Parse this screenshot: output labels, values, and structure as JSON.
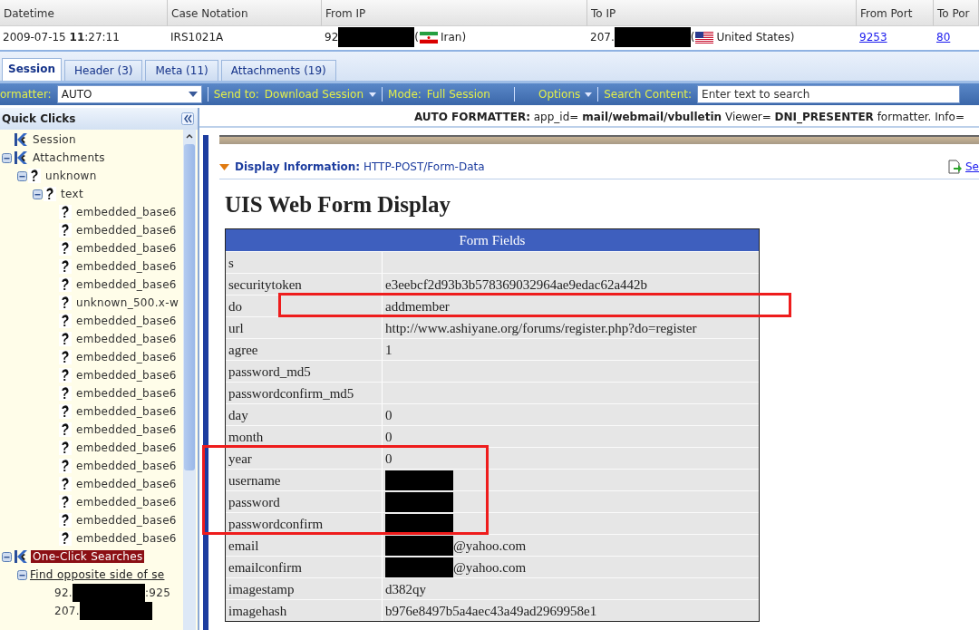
{
  "case_table": {
    "columns": [
      "Datetime",
      "Case Notation",
      "From IP",
      "To IP",
      "From Port",
      "To Por"
    ],
    "row": {
      "datetime": "2009-07-15 **11**:27:11",
      "case_notation": "IRS1021A",
      "from_ip": {
        "prefix": "92",
        "redacted": true,
        "lead": "(",
        "country": "Iran)"
      },
      "to_ip": {
        "prefix": "207.",
        "redacted": true,
        "lead": "(",
        "country": "United States)"
      },
      "from_port": "9253",
      "to_port": "80"
    }
  },
  "tabs": [
    {
      "label": "Session",
      "selected": true
    },
    {
      "label": "Header (3)",
      "selected": false
    },
    {
      "label": "Meta (11)",
      "selected": false
    },
    {
      "label": "Attachments (19)",
      "selected": false
    }
  ],
  "toolbar": {
    "formatter_label": "ormatter:",
    "formatter_value": "AUTO",
    "send_label": "Send to:",
    "send_value": "Download Session",
    "mode_label": "Mode:",
    "mode_value": "Full Session",
    "options": "Options",
    "search_label": "Search Content:",
    "search_placeholder": "Enter text to search"
  },
  "sidebar": {
    "title": "Quick Clicks",
    "tree": [
      {
        "label": "Session",
        "kind": "category",
        "selected": false
      },
      {
        "label": "Attachments",
        "kind": "category",
        "expanded": true,
        "selected": false,
        "children": [
          {
            "label": "unknown",
            "kind": "file",
            "expanded": true,
            "selected": false,
            "children": [
              {
                "label": "text",
                "kind": "file",
                "expanded": true,
                "selected": false,
                "children": [
                  {
                    "label": "embedded_base6",
                    "kind": "file",
                    "selected": false
                  },
                  {
                    "label": "embedded_base6",
                    "kind": "file",
                    "selected": false
                  },
                  {
                    "label": "embedded_base6",
                    "kind": "file",
                    "selected": false
                  },
                  {
                    "label": "embedded_base6",
                    "kind": "file",
                    "selected": false
                  },
                  {
                    "label": "embedded_base6",
                    "kind": "file",
                    "selected": false
                  },
                  {
                    "label": "unknown_500.x-w",
                    "kind": "file",
                    "selected": false
                  },
                  {
                    "label": "embedded_base6",
                    "kind": "file",
                    "selected": false
                  },
                  {
                    "label": "embedded_base6",
                    "kind": "file",
                    "selected": false
                  },
                  {
                    "label": "embedded_base6",
                    "kind": "file",
                    "selected": false
                  },
                  {
                    "label": "embedded_base6",
                    "kind": "file",
                    "selected": false
                  },
                  {
                    "label": "embedded_base6",
                    "kind": "file",
                    "selected": false
                  },
                  {
                    "label": "embedded_base6",
                    "kind": "file",
                    "selected": false
                  },
                  {
                    "label": "embedded_base6",
                    "kind": "file",
                    "selected": false
                  },
                  {
                    "label": "embedded_base6",
                    "kind": "file",
                    "selected": false
                  },
                  {
                    "label": "embedded_base6",
                    "kind": "file",
                    "selected": false
                  },
                  {
                    "label": "embedded_base6",
                    "kind": "file",
                    "selected": false
                  },
                  {
                    "label": "embedded_base6",
                    "kind": "file",
                    "selected": false
                  },
                  {
                    "label": "embedded_base6",
                    "kind": "file",
                    "selected": false
                  },
                  {
                    "label": "embedded_base6",
                    "kind": "file",
                    "selected": false
                  }
                ]
              }
            ]
          }
        ]
      },
      {
        "label": "One-Click Searches",
        "kind": "category",
        "expanded": true,
        "selected": true,
        "children": [
          {
            "label": "Find opposite side of se",
            "kind": "link",
            "expanded": true,
            "selected": false,
            "children": [
              {
                "label": "92.",
                "redacted": true,
                "suffix": ":925",
                "kind": "address",
                "selected": false
              },
              {
                "label": "207.",
                "redacted": true,
                "kind": "address",
                "selected": false
              }
            ]
          }
        ]
      }
    ]
  },
  "content": {
    "formatter_line": "**AUTO FORMATTER:** app_id= **mail/webmail/vbulletin** Viewer= **DNI_PRESENTER** formatter. Info=",
    "display_label": "Display Information:",
    "display_value": "HTTP-POST/Form-Data",
    "side_link": "Se",
    "heading": "UIS Web Form Display",
    "form": {
      "title": "Form Fields",
      "rows": [
        {
          "name": "s",
          "value": "",
          "redacted": false,
          "boxed": false
        },
        {
          "name": "securitytoken",
          "value": "e3eebcf2d93b3b578369032964ae9edac62a442b",
          "redacted": false,
          "boxed": false
        },
        {
          "name": "do",
          "value": "addmember",
          "redacted": false,
          "boxed": true
        },
        {
          "name": "url",
          "value": "http://www.ashiyane.org/forums/register.php?do=register",
          "redacted": false,
          "boxed": false
        },
        {
          "name": "agree",
          "value": "1",
          "redacted": false,
          "boxed": false
        },
        {
          "name": "password_md5",
          "value": "",
          "redacted": false,
          "boxed": false
        },
        {
          "name": "passwordconfirm_md5",
          "value": "",
          "redacted": false,
          "boxed": false
        },
        {
          "name": "day",
          "value": "0",
          "redacted": false,
          "boxed": false
        },
        {
          "name": "month",
          "value": "0",
          "redacted": false,
          "boxed": false
        },
        {
          "name": "year",
          "value": "0",
          "redacted": false,
          "boxed": true
        },
        {
          "name": "username",
          "value": "",
          "redacted": true,
          "boxed": true
        },
        {
          "name": "password",
          "value": "",
          "redacted": true,
          "boxed": true
        },
        {
          "name": "passwordconfirm",
          "value": "",
          "redacted": true,
          "boxed": true
        },
        {
          "name": "email",
          "value": "@yahoo.com",
          "redacted": true,
          "boxed": false
        },
        {
          "name": "emailconfirm",
          "value": "@yahoo.com",
          "redacted": true,
          "boxed": false
        },
        {
          "name": "imagestamp",
          "value": "d382qy",
          "redacted": false,
          "boxed": false
        },
        {
          "name": "imagehash",
          "value": "b976e8497b5a4aec43a49ad2969958e1",
          "redacted": false,
          "boxed": false
        }
      ]
    }
  }
}
